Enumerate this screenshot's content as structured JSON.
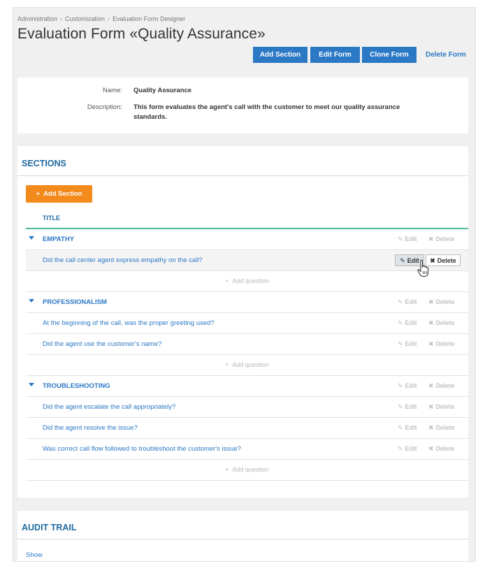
{
  "breadcrumb": [
    "Administration",
    "Customization",
    "Evaluation Form Designer"
  ],
  "page_title": "Evaluation Form «Quality Assurance»",
  "toolbar": {
    "add_section": "Add Section",
    "edit_form": "Edit Form",
    "clone_form": "Clone Form",
    "delete_form": "Delete Form"
  },
  "info": {
    "name_label": "Name:",
    "name_value": "Quality Assurance",
    "description_label": "Description:",
    "description_line1": "This form evaluates the agent's call with the customer to meet our quality assurance",
    "description_line2": "standards."
  },
  "sections": {
    "title": "SECTIONS",
    "add_button": "Add Section",
    "column_title": "TITLE",
    "edit_label": "Edit",
    "delete_label": "Delete",
    "add_question": "Add question",
    "groups": [
      {
        "name": "EMPATHY",
        "questions": [
          "Did the call center agent express empathy on the call?"
        ]
      },
      {
        "name": "PROFESSIONALISM",
        "questions": [
          "At the beginning of the call, was the proper greeting used?",
          "Did the agent use the customer's name?"
        ]
      },
      {
        "name": "TROUBLESHOOTING",
        "questions": [
          "Did the agent escalate the call appropriately?",
          "Did the agent resolve the issue?",
          "Was correct call flow followed to troubleshoot the customer's issue?"
        ]
      }
    ]
  },
  "audit": {
    "title": "AUDIT TRAIL",
    "show": "Show"
  },
  "colors": {
    "accent": "#2b78c5",
    "orange": "#f28a1c",
    "teal": "#55b79d"
  }
}
